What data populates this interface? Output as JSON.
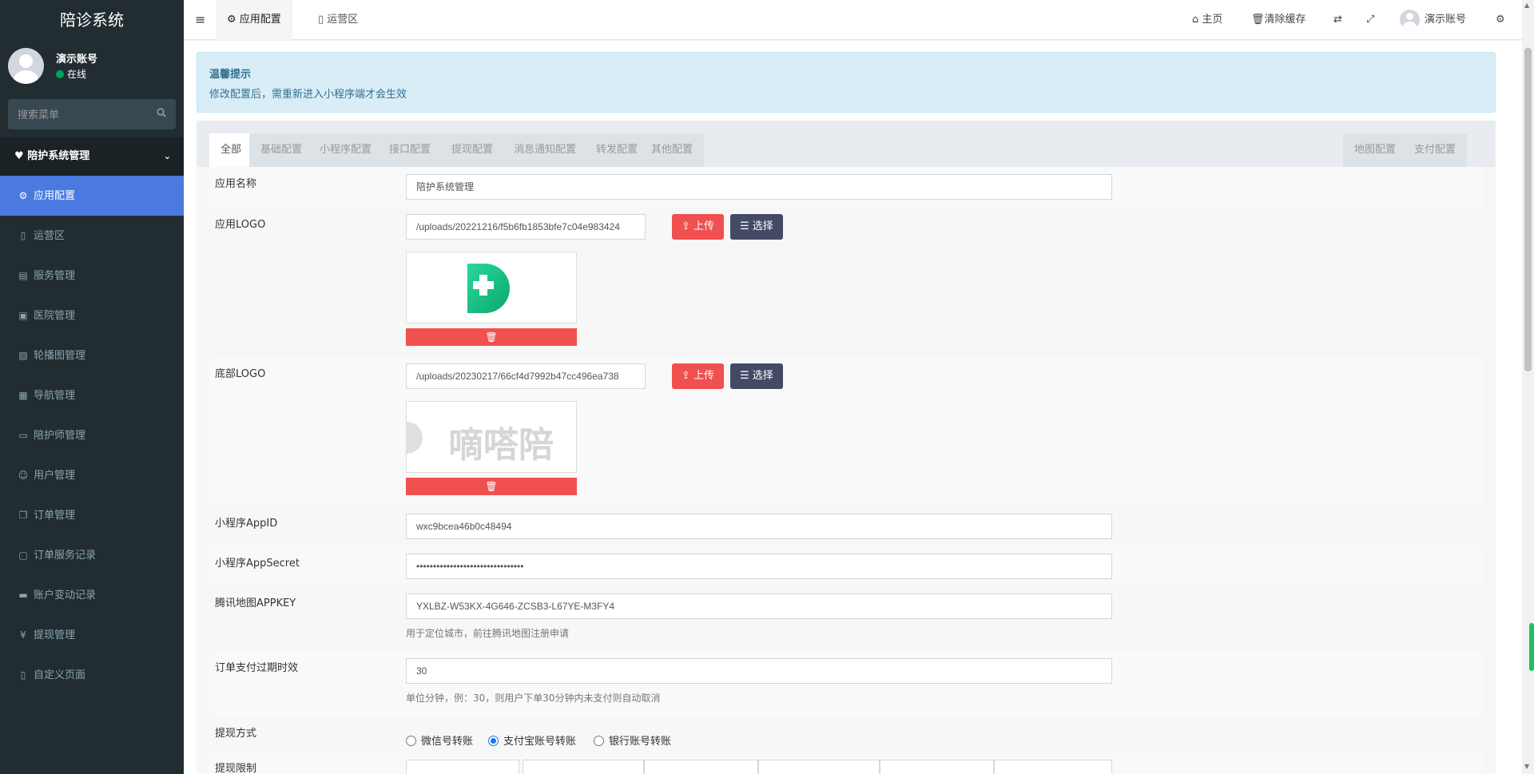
{
  "app": {
    "title": "陪诊系统"
  },
  "user": {
    "name": "演示账号",
    "status": "在线"
  },
  "sidebar": {
    "search_placeholder": "搜索菜单",
    "group": "陪护系统管理",
    "items": [
      {
        "label": "应用配置",
        "icon": "gear-icon",
        "active": true
      },
      {
        "label": "运营区",
        "icon": "map-icon"
      },
      {
        "label": "服务管理",
        "icon": "list-icon"
      },
      {
        "label": "医院管理",
        "icon": "clipboard-icon"
      },
      {
        "label": "轮播图管理",
        "icon": "image-icon"
      },
      {
        "label": "导航管理",
        "icon": "grid-icon"
      },
      {
        "label": "陪护师管理",
        "icon": "id-card-icon"
      },
      {
        "label": "用户管理",
        "icon": "user-icon"
      },
      {
        "label": "订单管理",
        "icon": "copy-icon"
      },
      {
        "label": "订单服务记录",
        "icon": "save-icon"
      },
      {
        "label": "账户变动记录",
        "icon": "card-icon"
      },
      {
        "label": "提现管理",
        "icon": "yen-icon"
      },
      {
        "label": "自定义页面",
        "icon": "file-icon"
      }
    ]
  },
  "header": {
    "tabs": [
      {
        "label": "应用配置",
        "icon": "gear-icon"
      },
      {
        "label": "运营区",
        "icon": "map-icon"
      }
    ],
    "home": "主页",
    "clear_cache": "清除缓存",
    "user": "演示账号"
  },
  "callout": {
    "title": "温馨提示",
    "body": "修改配置后，需重新进入小程序端才会生效"
  },
  "config_tabs": {
    "left": [
      "全部",
      "基础配置",
      "小程序配置",
      "接口配置",
      "提现配置",
      "消息通知配置",
      "转发配置",
      "其他配置"
    ],
    "right": [
      "地图配置",
      "支付配置"
    ]
  },
  "form": {
    "app_name": {
      "label": "应用名称",
      "value": "陪护系统管理"
    },
    "app_logo": {
      "label": "应用LOGO",
      "value": "/uploads/20221216/f5b6fb1853bfe7c04e983424"
    },
    "footer_logo": {
      "label": "底部LOGO",
      "value": "/uploads/20230217/66cf4d7992b47cc496ea738",
      "preview_text": "嘀嗒陪"
    },
    "appid": {
      "label": "小程序AppID",
      "value": "wxc9bcea46b0c48494"
    },
    "appsecret": {
      "label": "小程序AppSecret",
      "value": "••••••••••••••••••••••••••••••••"
    },
    "map_key": {
      "label": "腾讯地图APPKEY",
      "value": "YXLBZ-W53KX-4G646-ZCSB3-L67YE-M3FY4",
      "help": "用于定位城市，前往腾讯地图注册申请"
    },
    "expire": {
      "label": "订单支付过期时效",
      "value": "30",
      "help": "单位分钟，例：30，则用户下单30分钟内未支付则自动取消"
    },
    "withdraw": {
      "label": "提现方式",
      "options": [
        "微信号转账",
        "支付宝账号转账",
        "银行账号转账"
      ],
      "selected": 1
    },
    "withdraw_limit": {
      "label": "提现限制"
    },
    "upload_label": "上传",
    "select_label": "选择"
  }
}
